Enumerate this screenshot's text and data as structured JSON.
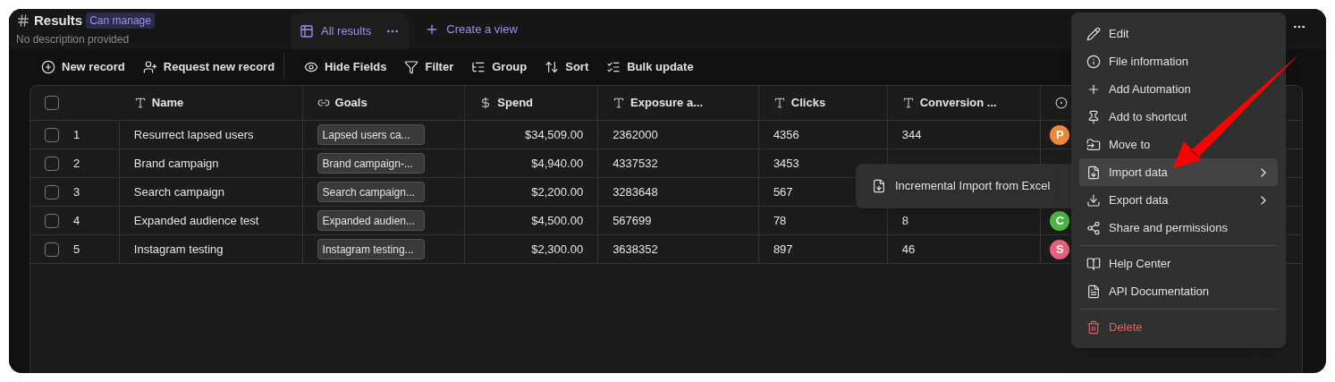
{
  "header": {
    "title": "Results",
    "badge": "Can manage",
    "description": "No description provided"
  },
  "views": [
    {
      "label": "All results",
      "selected": true
    },
    {
      "label": "Create a view",
      "selected": false
    }
  ],
  "toolbar": [
    {
      "label": "New record"
    },
    {
      "label": "Request new record"
    },
    {
      "label": "Hide Fields"
    },
    {
      "label": "Filter"
    },
    {
      "label": "Group"
    },
    {
      "label": "Sort"
    },
    {
      "label": "Bulk update"
    }
  ],
  "table": {
    "select_all": {
      "checked": false
    },
    "columns": [
      {
        "label": "Name"
      },
      {
        "label": "Goals"
      },
      {
        "label": "Spend"
      },
      {
        "label": "Exposure a..."
      },
      {
        "label": "Clicks"
      },
      {
        "label": "Conversion ..."
      },
      {}
    ],
    "rows": [
      {
        "checked": false,
        "number": "1",
        "name": "Resurrect lapsed users",
        "goal": "Lapsed users ca...",
        "spend": "$34,509.00",
        "exposure": "2362000",
        "clicks": "4356",
        "conversion": "344",
        "tag": {
          "text": "P",
          "color": "#f0883a"
        }
      },
      {
        "checked": false,
        "number": "2",
        "name": "Brand campaign",
        "goal": "Brand campaign-...",
        "spend": "$4,940.00",
        "exposure": "4337532",
        "clicks": "3453"
      },
      {
        "checked": false,
        "number": "3",
        "name": "Search campaign",
        "goal": "Search campaign...",
        "spend": "$2,200.00",
        "exposure": "3283648",
        "clicks": "567"
      },
      {
        "checked": false,
        "number": "4",
        "name": "Expanded audience test",
        "goal": "Expanded audien...",
        "spend": "$4,500.00",
        "exposure": "567699",
        "clicks": "78",
        "conversion": "8",
        "tag": {
          "text": "C",
          "color": "#4fb848"
        }
      },
      {
        "checked": false,
        "number": "5",
        "name": "Instagram testing",
        "goal": "Instagram testing...",
        "spend": "$2,300.00",
        "exposure": "3638352",
        "clicks": "897",
        "conversion": "46",
        "tag": {
          "text": "S",
          "color": "#e8607a"
        }
      }
    ]
  },
  "menu": {
    "items": [
      {
        "kind": "item",
        "label": "Edit",
        "selected": false
      },
      {
        "kind": "item",
        "label": "File information",
        "selected": false
      },
      {
        "kind": "item",
        "label": "Add Automation",
        "selected": false
      },
      {
        "kind": "item",
        "label": "Add to shortcut",
        "selected": false
      },
      {
        "kind": "item",
        "label": "Move to",
        "selected": false
      },
      {
        "kind": "submenu",
        "label": "Import data",
        "selected": true
      },
      {
        "kind": "submenu",
        "label": "Export data",
        "selected": false
      },
      {
        "kind": "item",
        "label": "Share and permissions",
        "selected": false
      },
      {
        "kind": "divider"
      },
      {
        "kind": "item",
        "label": "Help Center",
        "selected": false
      },
      {
        "kind": "item",
        "label": "API Documentation",
        "selected": false
      },
      {
        "kind": "divider"
      },
      {
        "kind": "danger",
        "label": "Delete",
        "selected": false
      }
    ]
  },
  "submenu": {
    "items": [
      {
        "label": "Incremental Import from Excel"
      }
    ]
  }
}
